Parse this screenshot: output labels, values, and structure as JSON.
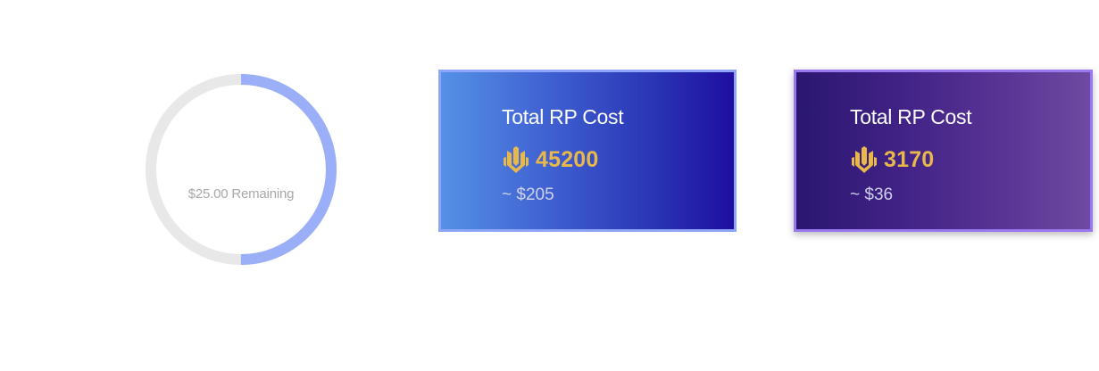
{
  "budget": {
    "remaining_label": "$25.00 Remaining",
    "progress_fraction": 0.5,
    "track_color": "#e8e8e8",
    "fill_color": "#9aaff8"
  },
  "cards": [
    {
      "title": "Total RP Cost",
      "rp_icon": "rp-coin-icon",
      "rp_amount": "45200",
      "usd_estimate": "~ $205"
    },
    {
      "title": "Total RP Cost",
      "rp_icon": "rp-coin-icon",
      "rp_amount": "3170",
      "usd_estimate": "~ $36"
    }
  ],
  "colors": {
    "rp_gold": "#e8b84a"
  }
}
